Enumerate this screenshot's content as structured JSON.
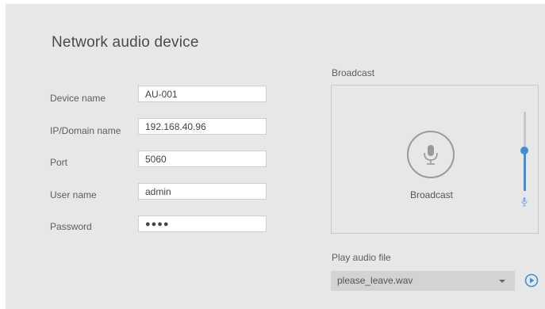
{
  "title": "Network audio device",
  "form": {
    "device_name": {
      "label": "Device name",
      "value": "AU-001"
    },
    "ip": {
      "label": "IP/Domain name",
      "value": "192.168.40.96"
    },
    "port": {
      "label": "Port",
      "value": "5060"
    },
    "user": {
      "label": "User name",
      "value": "admin"
    },
    "password": {
      "label": "Password",
      "value": "●●●●"
    }
  },
  "broadcast": {
    "section_label": "Broadcast",
    "button_caption": "Broadcast",
    "volume": 0.52,
    "accent": "#3d8fd8"
  },
  "play": {
    "section_label": "Play audio file",
    "selected_file": "please_leave.wav"
  },
  "icons": [
    "microphone-icon",
    "volume-mic-icon",
    "chevron-down-icon",
    "play-icon"
  ]
}
